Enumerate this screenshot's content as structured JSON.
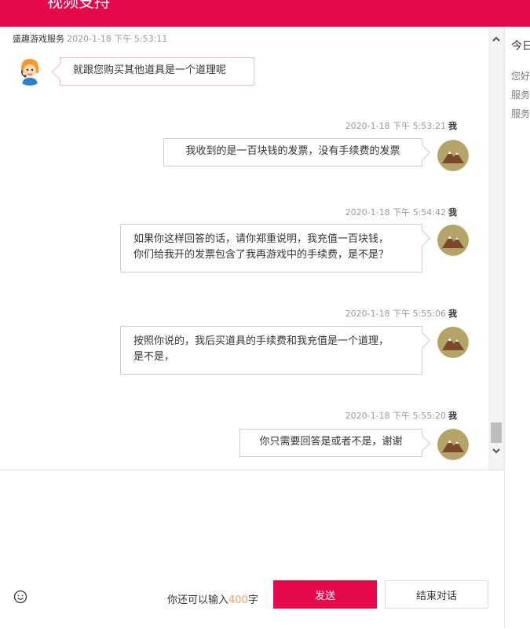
{
  "header": {
    "title": "视频支持"
  },
  "messages": [
    {
      "sender": "盛趣游戏服务",
      "time": "2020-1-18 下午 5:53:11",
      "text": "就跟您购买其他道具是一个道理呢"
    },
    {
      "sender": "我",
      "time": "2020-1-18 下午 5:53:21",
      "text": "我收到的是一百块钱的发票，没有手续费的发票"
    },
    {
      "sender": "我",
      "time": "2020-1-18 下午 5:54:42",
      "lines": [
        "如果你这样回答的话，请你郑重说明，我充值一百块钱，",
        "你们给我开的发票包含了我再游戏中的手续费，是不是？"
      ]
    },
    {
      "sender": "我",
      "time": "2020-1-18 下午 5:55:06",
      "lines": [
        "按照你说的，我后买道具的手续费和我充值是一个道理，",
        "是不是，"
      ]
    },
    {
      "sender": "我",
      "time": "2020-1-18 下午 5:55:20",
      "text": "你只需要回答是或者不是，谢谢"
    }
  ],
  "right_panel": {
    "title": "今日",
    "lines": [
      "您好",
      "服务",
      "服务"
    ]
  },
  "input": {
    "counter_prefix": "你还可以输入",
    "counter_value": "400",
    "counter_suffix": "字",
    "send_label": "发送",
    "end_label": "结束对话"
  },
  "icons": {
    "emoji": "smiley-icon",
    "scroll_up": "chevron-up-icon",
    "scroll_down": "chevron-down-icon"
  },
  "colors": {
    "brand": "#e5084a",
    "counter_number": "#f3a260"
  }
}
